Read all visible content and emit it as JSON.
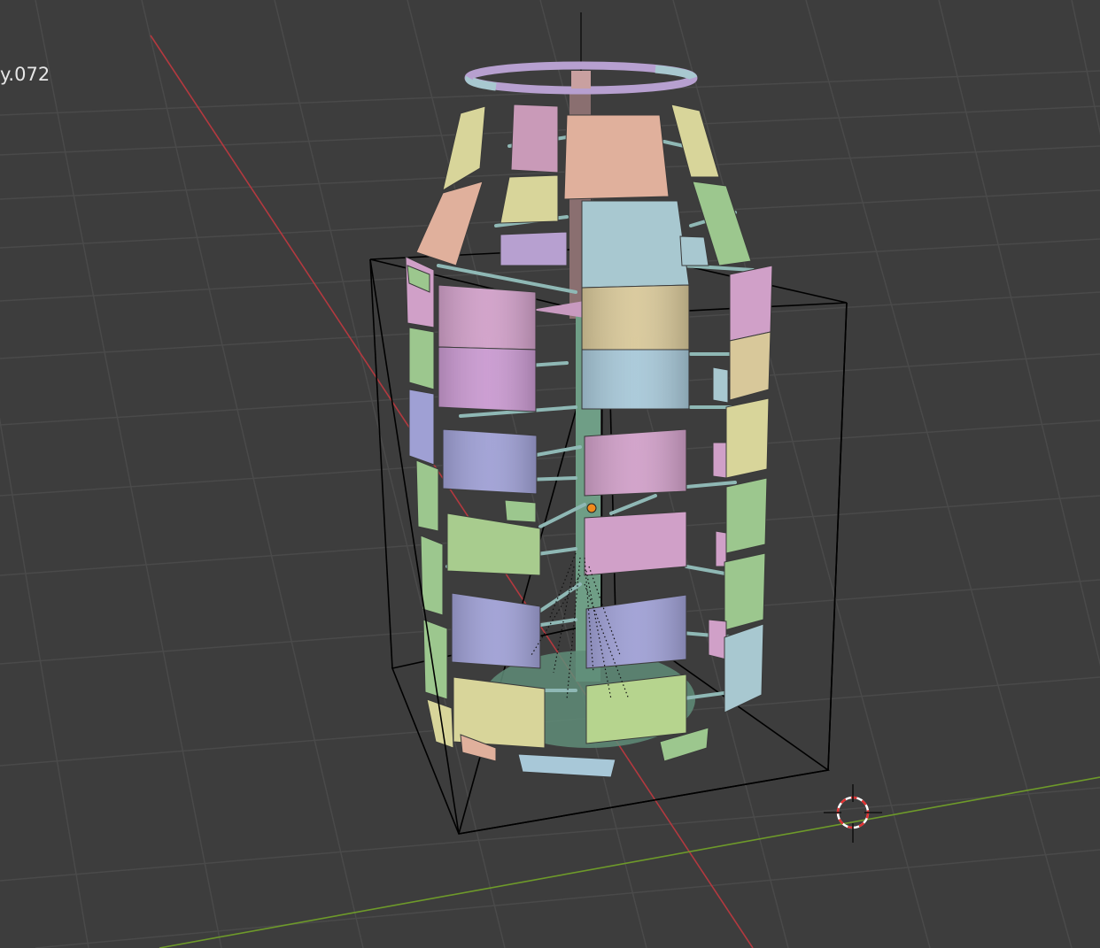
{
  "viewport": {
    "object_name": "y.072",
    "background_color": "#3d3d3d",
    "grid_color": "#4a4a4a",
    "x_axis_color": "#b3393f",
    "y_axis_color": "#6e9a2a",
    "z_axis_color": "#111111",
    "bounding_box_color": "#000000",
    "origin_color": "#f08a1c",
    "cursor_icon": "3d-cursor-icon",
    "panel_colors": [
      "#d0a0c8",
      "#9cc78e",
      "#9fa0d4",
      "#d8d59a",
      "#a8c8d0",
      "#e0b0a0"
    ]
  }
}
